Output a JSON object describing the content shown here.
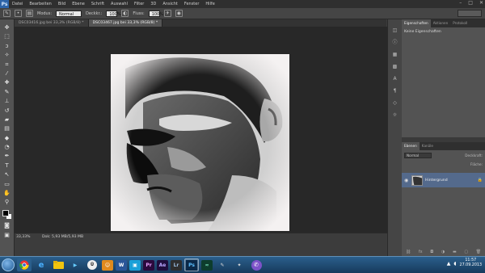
{
  "app": {
    "logo": "Ps"
  },
  "menu": [
    "Datei",
    "Bearbeiten",
    "Bild",
    "Ebene",
    "Schrift",
    "Auswahl",
    "Filter",
    "3D",
    "Ansicht",
    "Fenster",
    "Hilfe"
  ],
  "options": {
    "mode_label": "Modus:",
    "mode_value": "Normal",
    "opacity_label": "Deckkr.:",
    "opacity_value": "100%",
    "flow_label": "Fluss:",
    "flow_value": "100%"
  },
  "doc_tabs": [
    {
      "label": "DSC03416.jpg bei 33,3% (RGB/8) *",
      "active": false
    },
    {
      "label": "DSC03467.jpg bei 33,3% (RGB/8) *",
      "active": true
    }
  ],
  "status": {
    "zoom": "33,33%",
    "doc_info": "Dok: 5,93 MB/5,93 MB"
  },
  "panels": {
    "props_tabs": [
      "Eigenschaften",
      "Aktionen",
      "Protokoll"
    ],
    "props_empty": "Keine Eigenschaften",
    "layer_tabs": [
      "Ebenen",
      "Kanäle"
    ],
    "blend_mode": "Normal",
    "opacity_label": "Deckkraft:",
    "fill_label": "Fläche:",
    "layer_name": "Hintergrund"
  },
  "taskbar": {
    "apps": [
      "chrome",
      "ie",
      "explorer",
      "media",
      "html",
      "word",
      "app",
      "premiere",
      "after-effects",
      "lightroom",
      "photoshop",
      "audition",
      "tool",
      "tool2",
      "viber"
    ],
    "time": "11:57",
    "date": "27.09.2013"
  },
  "colors": {
    "accent": "#546a8c",
    "canvas_bg": "#282828"
  }
}
